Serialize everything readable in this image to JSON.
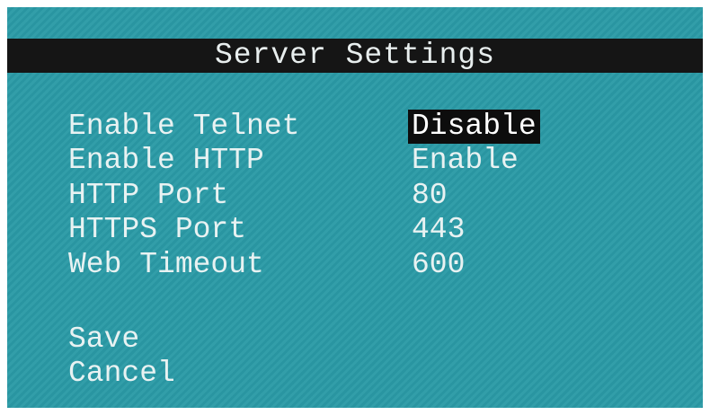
{
  "screen": {
    "title": "Server Settings",
    "background_color": "#2a9aa6",
    "title_bar_color": "#151515",
    "settings": [
      {
        "label": "Enable Telnet",
        "value": "Disable",
        "selected": true
      },
      {
        "label": "Enable HTTP",
        "value": "Enable",
        "selected": false
      },
      {
        "label": "HTTP Port",
        "value": "80",
        "selected": false
      },
      {
        "label": "HTTPS Port",
        "value": "443",
        "selected": false
      },
      {
        "label": "Web Timeout",
        "value": "600",
        "selected": false
      }
    ],
    "actions": {
      "save_label": "Save",
      "cancel_label": "Cancel"
    }
  }
}
